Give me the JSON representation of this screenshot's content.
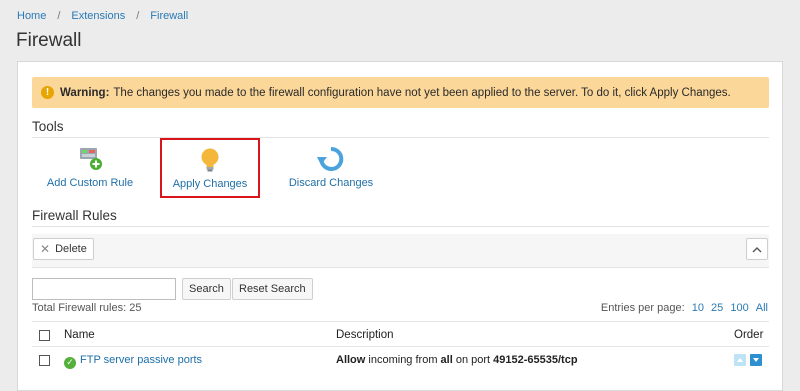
{
  "breadcrumb": {
    "items": [
      "Home",
      "Extensions",
      "Firewall"
    ],
    "separator": "/"
  },
  "page": {
    "title": "Firewall"
  },
  "warning": {
    "icon": "warning-icon",
    "prefix": "Warning:",
    "message": "The changes you made to the firewall configuration have not yet been applied to the server. To do it, click Apply Changes."
  },
  "tools": {
    "heading": "Tools",
    "items": [
      {
        "label": "Add Custom Rule",
        "icon": "add-rule-icon"
      },
      {
        "label": "Apply Changes",
        "icon": "lightbulb-icon",
        "highlighted": true
      },
      {
        "label": "Discard Changes",
        "icon": "undo-icon"
      }
    ]
  },
  "rules": {
    "heading": "Firewall Rules",
    "delete_label": "Delete",
    "search_value": "",
    "search_label": "Search",
    "reset_label": "Reset Search",
    "total_text": "Total Firewall rules: 25",
    "entries_label": "Entries per page:",
    "entries_options": [
      "10",
      "25",
      "100",
      "All"
    ],
    "columns": [
      "Name",
      "Description",
      "Order"
    ],
    "rows": [
      {
        "name": "FTP server passive ports",
        "desc_action": "Allow",
        "desc_mid": "incoming from",
        "desc_from": "all",
        "desc_mid2": "on port",
        "desc_port": "49152-65535/tcp"
      }
    ]
  },
  "colors": {
    "link": "#1f6fa8",
    "warning_bg": "#fbd799",
    "highlight": "#d9151b",
    "ok": "#53b03a"
  }
}
